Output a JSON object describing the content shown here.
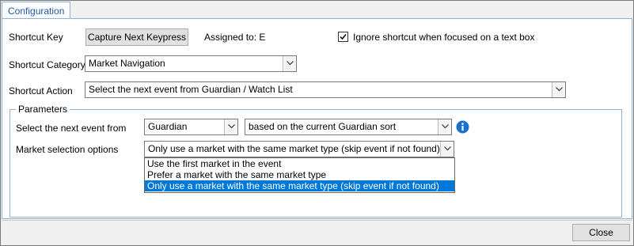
{
  "tab": {
    "label": "Configuration"
  },
  "shortcut_key": {
    "label": "Shortcut Key",
    "capture_button": "Capture Next Keypress",
    "assigned_to": "Assigned to: E"
  },
  "ignore_checkbox": {
    "checked": true,
    "label": "Ignore shortcut when focused on a text box"
  },
  "shortcut_category": {
    "label": "Shortcut Category",
    "value": "Market Navigation"
  },
  "shortcut_action": {
    "label": "Shortcut Action",
    "value": "Select the next event from Guardian / Watch List"
  },
  "parameters": {
    "title": "Parameters",
    "next_event": {
      "label": "Select the next event from",
      "source_value": "Guardian",
      "sort_value": "based on the current Guardian sort"
    },
    "market_selection": {
      "label": "Market selection options",
      "value": "Only use a market with the same market type (skip event if not found)",
      "options": [
        "Use the first market in the event",
        "Prefer a market with the same market type",
        "Only use a market with the same market type (skip event if not found)"
      ],
      "selected_index": 2
    }
  },
  "footer": {
    "close_button": "Close"
  },
  "colors": {
    "accent": "#0078d7",
    "tab_text": "#1e5aa8",
    "border": "#8fb2d9",
    "info_icon": "#1a6fd0"
  },
  "icons": {
    "info": "info-icon",
    "dropdown": "chevron-down-icon",
    "check": "checkmark-icon"
  }
}
